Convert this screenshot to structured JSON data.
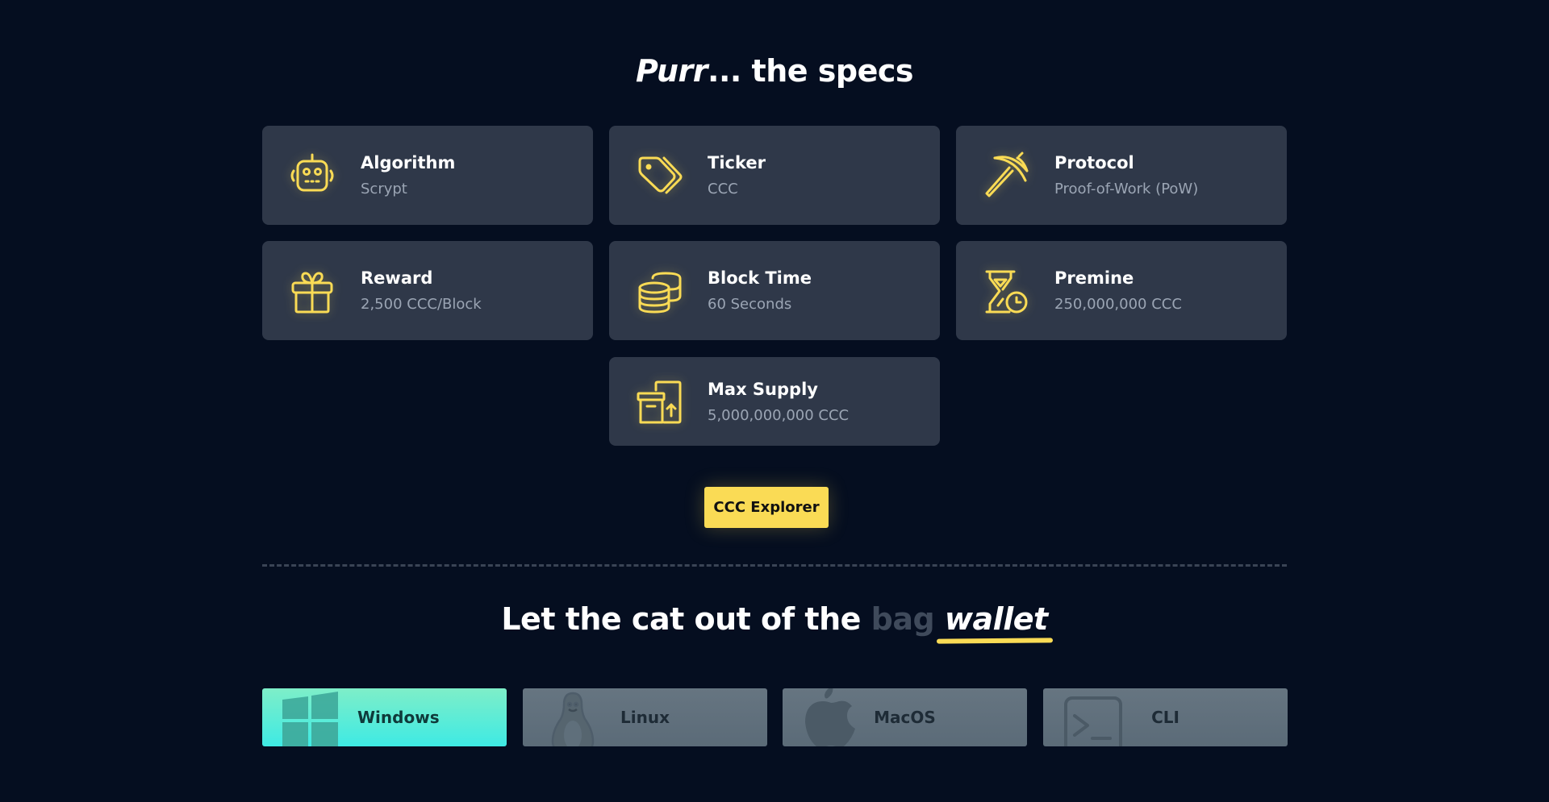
{
  "specs_section": {
    "title_italic": "Purr",
    "title_rest": "... the specs",
    "cards": [
      {
        "icon": "robot-icon",
        "label": "Algorithm",
        "value": "Scrypt"
      },
      {
        "icon": "tags-icon",
        "label": "Ticker",
        "value": "CCC"
      },
      {
        "icon": "pickaxe-icon",
        "label": "Protocol",
        "value": "Proof-of-Work (PoW)"
      },
      {
        "icon": "gift-icon",
        "label": "Reward",
        "value": "2,500 CCC/Block"
      },
      {
        "icon": "coins-icon",
        "label": "Block Time",
        "value": "60 Seconds"
      },
      {
        "icon": "hourglass-clock-icon",
        "label": "Premine",
        "value": "250,000,000 CCC"
      },
      {
        "icon": "box-upload-icon",
        "label": "Max Supply",
        "value": "5,000,000,000 CCC"
      }
    ],
    "explorer_button": "CCC Explorer"
  },
  "wallet_section": {
    "title_prefix": "Let the cat out of the ",
    "title_struck": "bag",
    "title_highlight": "wallet",
    "platforms": [
      {
        "icon": "windows-icon",
        "label": "Windows",
        "active": true
      },
      {
        "icon": "linux-icon",
        "label": "Linux",
        "active": false
      },
      {
        "icon": "apple-icon",
        "label": "MacOS",
        "active": false
      },
      {
        "icon": "terminal-icon",
        "label": "CLI",
        "active": false
      }
    ]
  },
  "colors": {
    "background": "#050e20",
    "card": "#2f3849",
    "accent_yellow": "#fadb55",
    "active_gradient_top": "#7eeec8",
    "active_gradient_bottom": "#3eeae4",
    "inactive_platform": "#627280"
  }
}
